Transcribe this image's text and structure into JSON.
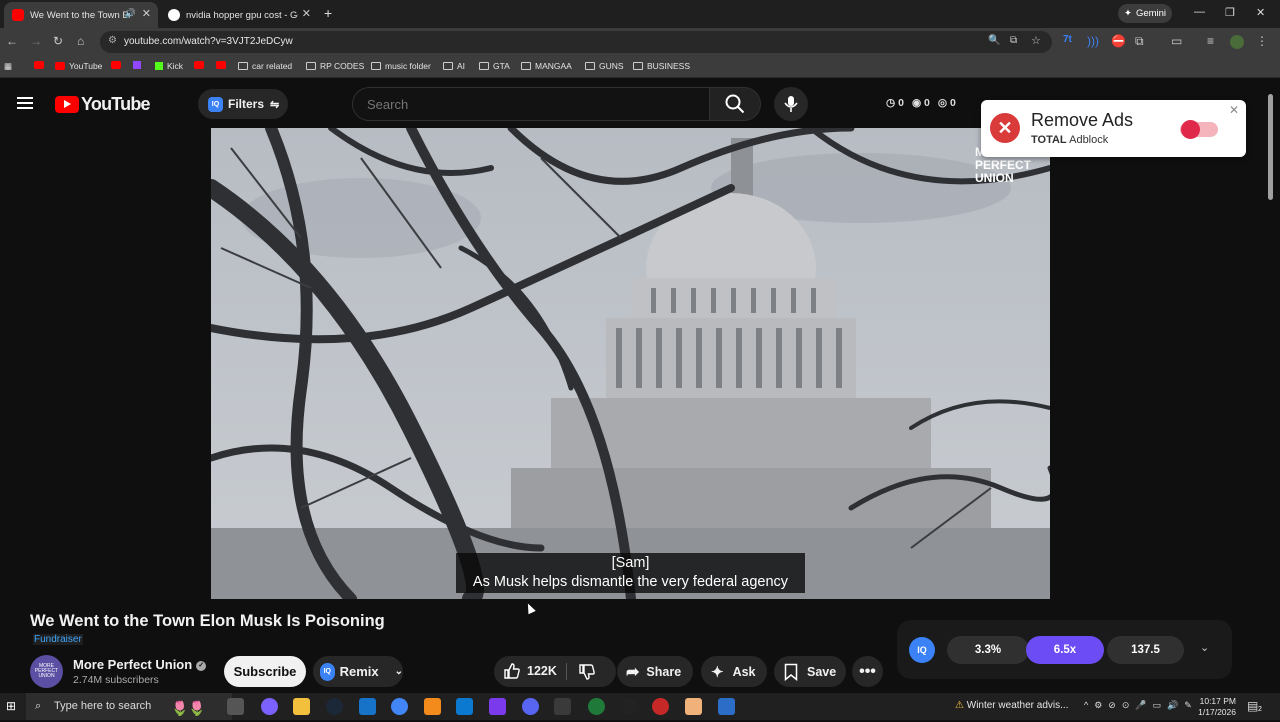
{
  "browser": {
    "tabs": [
      {
        "title": "We Went to the Town Elon Musk Is Poisoning",
        "active": true,
        "favicon": "youtube-icon"
      },
      {
        "title": "nvidia hopper gpu cost - Google Search",
        "active": false,
        "favicon": "google-icon"
      }
    ],
    "new_tab": "+",
    "gemini_label": "Gemini",
    "url": "youtube.com/watch?v=3VJT2JeDCyw",
    "bookmarks": [
      {
        "label": "",
        "type": "youtube"
      },
      {
        "label": "YouTube",
        "type": "youtube"
      },
      {
        "label": "",
        "type": "youtube"
      },
      {
        "label": "",
        "type": "twitch"
      },
      {
        "label": "Kick",
        "type": "kick"
      },
      {
        "label": "",
        "type": "youtube"
      },
      {
        "label": "",
        "type": "youtube"
      },
      {
        "label": "car related",
        "type": "folder"
      },
      {
        "label": "RP CODES",
        "type": "folder"
      },
      {
        "label": "music folder",
        "type": "folder"
      },
      {
        "label": "AI",
        "type": "folder"
      },
      {
        "label": "GTA",
        "type": "folder"
      },
      {
        "label": "MANGAA",
        "type": "folder"
      },
      {
        "label": "GUNS",
        "type": "folder"
      },
      {
        "label": "BUSINESS",
        "type": "folder"
      }
    ]
  },
  "youtube": {
    "logo_text": "YouTube",
    "filters_label": "Filters",
    "search_placeholder": "Search",
    "counters": [
      "0",
      "0",
      "0"
    ]
  },
  "adblock_popup": {
    "title": "Remove Ads",
    "brand": "TOTAL",
    "product": "Adblock",
    "toggle_on": false
  },
  "video": {
    "caption_speaker": "[Sam]",
    "caption_text": "As Musk helps dismantle the very federal agency",
    "watermark": [
      "MORE",
      "PERFECT",
      "UNION"
    ]
  },
  "watch": {
    "title": "We Went to the Town Elon Musk Is Poisoning",
    "badge": "Fundraiser",
    "channel_name": "More Perfect Union",
    "avatar_text": "MORE PERFECT UNION",
    "subscribers": "2.74M subscribers",
    "subscribe_label": "Subscribe",
    "remix_label": "Remix",
    "like_count": "122K",
    "share_label": "Share",
    "ask_label": "Ask",
    "save_label": "Save"
  },
  "speed_panel": {
    "values": [
      "3.3%",
      "6.5x",
      "137.5"
    ]
  },
  "taskbar": {
    "search_placeholder": "Type here to search",
    "weather": "Winter weather advis...",
    "time": "10:17 PM",
    "date": "1/17/2026",
    "notification_count": "2"
  },
  "colors": {
    "accent_red": "#ff0000",
    "speed_purple": "#6c4df5",
    "link_blue": "#3ea6ff"
  }
}
